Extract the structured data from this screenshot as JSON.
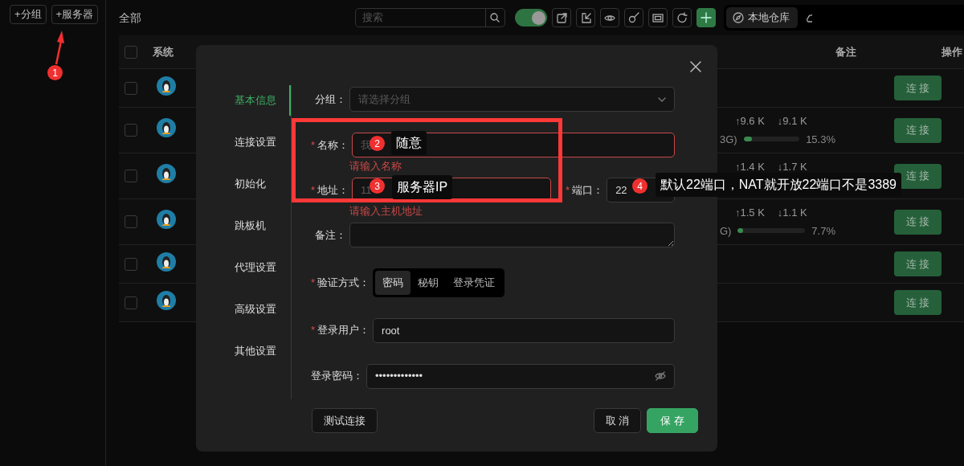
{
  "sidebar": {
    "buttons": [
      "+分组",
      "+服务器"
    ]
  },
  "toolbar": {
    "title": "全部",
    "search": {
      "placeholder": "搜索"
    },
    "toggle": {
      "on": true
    },
    "store_button": "本地仓库"
  },
  "table": {
    "all_checked": false,
    "columns": [
      "系统",
      "备注",
      "操作"
    ],
    "rows": [
      {
        "checked": false,
        "action": "连 接"
      },
      {
        "checked": false,
        "stats": {
          "upload": "↑9.6 K",
          "download": "↓9.1 K",
          "memory": "3G)",
          "level": 0.153,
          "percent": "15.3%"
        },
        "action": "连 接"
      },
      {
        "checked": false,
        "stats": {
          "upload": "↑1.4 K",
          "download": "↓1.7 K"
        },
        "action": "连 接"
      },
      {
        "checked": false,
        "stats": {
          "upload": "↑1.5 K",
          "download": "↓1.1 K",
          "memory": "G)",
          "level": 0.077,
          "percent": "7.7%"
        },
        "action": "连 接"
      },
      {
        "checked": false,
        "action": "连 接"
      },
      {
        "checked": false,
        "action": "连 接"
      }
    ]
  },
  "dialog": {
    "tabs": [
      {
        "label": "基本信息",
        "selected": true
      },
      {
        "label": "连接设置",
        "selected": false
      },
      {
        "label": "初始化",
        "selected": false
      },
      {
        "label": "跳板机",
        "selected": false
      },
      {
        "label": "代理设置",
        "selected": false
      },
      {
        "label": "高级设置",
        "selected": false
      },
      {
        "label": "其他设置",
        "selected": false
      }
    ],
    "fields": [
      {
        "kind": "select",
        "label": "分组：",
        "placeholder": "请选择分组"
      },
      {
        "kind": "text",
        "label": "名称：",
        "required_mark": "*",
        "placeholder": "我",
        "error": "请输入名称"
      },
      {
        "kind": "address",
        "label": "地址：",
        "required_mark": "*",
        "placeholder": "11",
        "error": "请输入主机地址",
        "port": {
          "label": "端口：",
          "required_mark": "*",
          "value": "22"
        }
      },
      {
        "kind": "textarea",
        "label": "备注："
      },
      {
        "kind": "segmented",
        "label": "验证方式：",
        "required_mark": "*",
        "options": [
          {
            "label": "密码",
            "selected": true
          },
          {
            "label": "秘钥",
            "selected": false
          },
          {
            "label": "登录凭证",
            "selected": false
          }
        ]
      },
      {
        "kind": "text",
        "label": "登录用户：",
        "required_mark": "*",
        "value": "root"
      },
      {
        "kind": "password",
        "label": "登录密码：",
        "value": "•••••••••••••"
      }
    ],
    "buttons": {
      "test": "测试连接",
      "cancel": "取 消",
      "save": "保 存"
    }
  },
  "annotations": [
    {
      "number": "1"
    },
    {
      "number": "2",
      "note": "随意"
    },
    {
      "number": "3",
      "note": "服务器IP"
    },
    {
      "number": "4",
      "note": "默认22端口，NAT就开放22端口不是3389"
    }
  ]
}
